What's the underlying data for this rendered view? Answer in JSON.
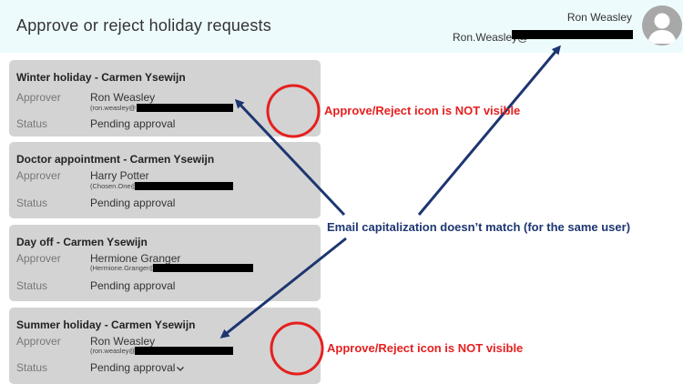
{
  "header": {
    "title": "Approve or reject holiday requests",
    "user_name": "Ron Weasley",
    "user_email": "Ron.Weasley@"
  },
  "requests": [
    {
      "title": "Winter holiday - Carmen Ysewijn",
      "approver_label": "Approver",
      "approver_name": "Ron Weasley",
      "approver_email": "(ron.weasley@",
      "status_label": "Status",
      "status_value": "Pending approval"
    },
    {
      "title": "Doctor appointment - Carmen Ysewijn",
      "approver_label": "Approver",
      "approver_name": "Harry Potter",
      "approver_email": "(Chosen.One@",
      "status_label": "Status",
      "status_value": "Pending approval"
    },
    {
      "title": "Day off - Carmen Ysewijn",
      "approver_label": "Approver",
      "approver_name": "Hermione Granger",
      "approver_email": "(Hermione.Granger@",
      "status_label": "Status",
      "status_value": "Pending approval"
    },
    {
      "title": "Summer holiday - Carmen Ysewijn",
      "approver_label": "Approver",
      "approver_name": "Ron Weasley",
      "approver_email": "(ron.weasley@",
      "status_label": "Status",
      "status_value": "Pending approval"
    }
  ],
  "annotations": {
    "icon_not_visible": "Approve/Reject icon is NOT visible",
    "email_capitalization": "Email capitalization doesn’t match (for the same user)"
  },
  "colors": {
    "header_bg": "#eefbfd",
    "card_bg": "#d3d3d3",
    "annotation_red": "#e5201f",
    "annotation_blue": "#1d3670",
    "avatar": "#a8a8a8"
  },
  "icons": {
    "avatar": "user-silhouette-icon",
    "status_dropdown": "chevron-down-icon"
  }
}
